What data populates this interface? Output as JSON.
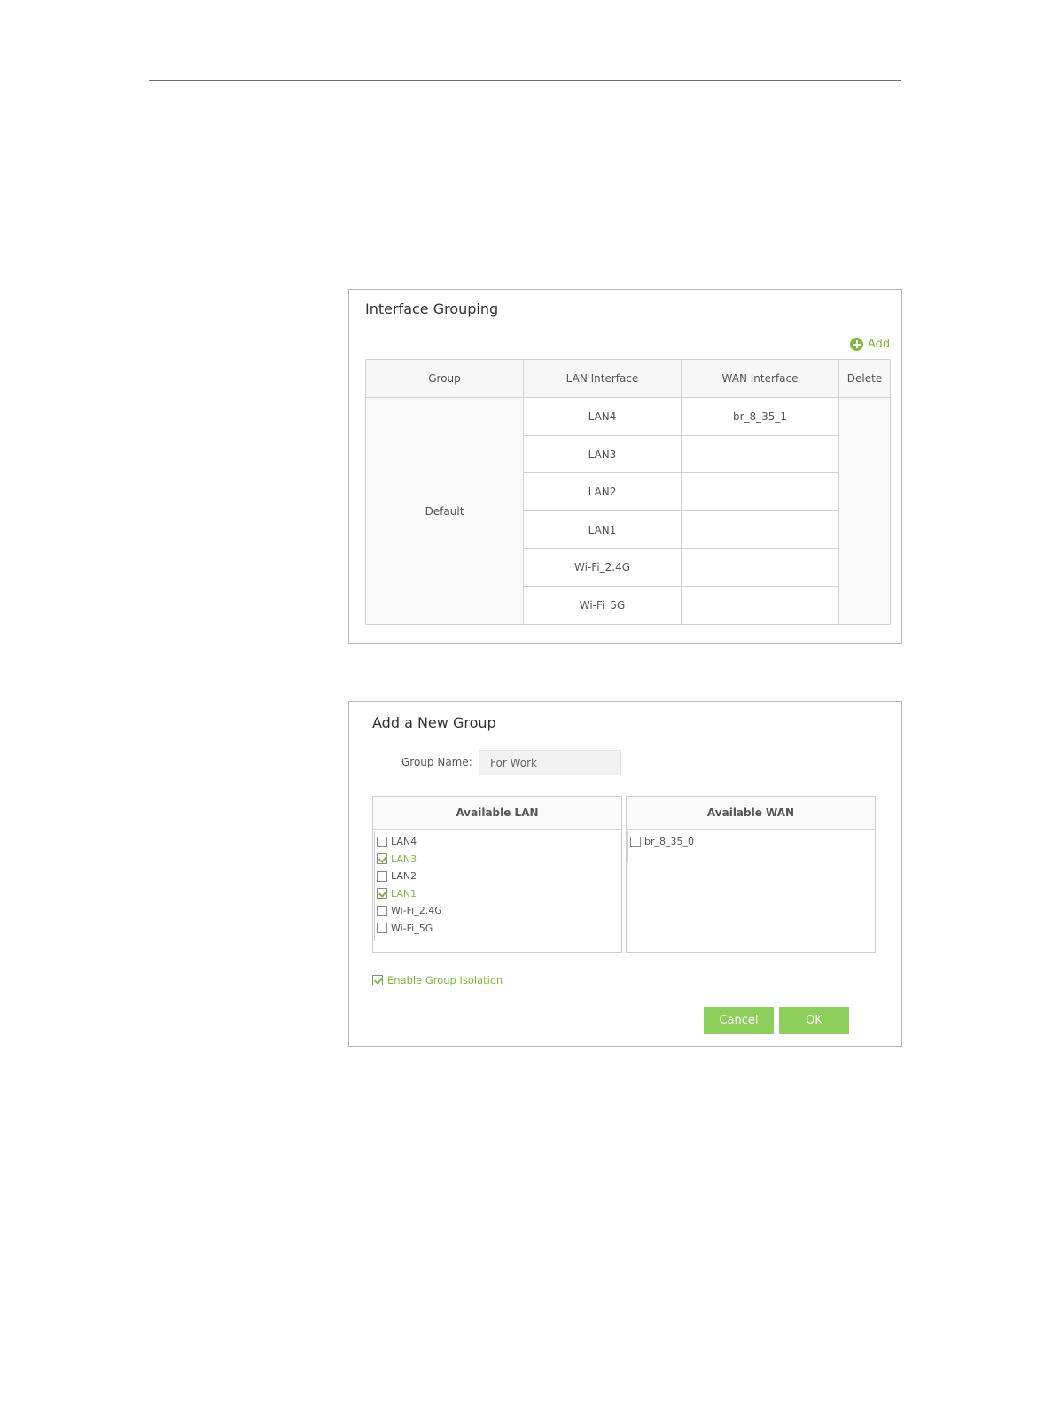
{
  "interface_grouping": {
    "title": "Interface Grouping",
    "add_label": "Add",
    "headers": {
      "group": "Group",
      "lan": "LAN Interface",
      "wan": "WAN Interface",
      "delete": "Delete"
    },
    "group_name": "Default",
    "lan_rows": [
      "LAN4",
      "LAN3",
      "LAN2",
      "LAN1",
      "Wi-Fi_2.4G",
      "Wi-Fi_5G"
    ],
    "wan_rows": [
      "br_8_35_1",
      "",
      "",
      "",
      "",
      ""
    ]
  },
  "add_group": {
    "title": "Add a New Group",
    "group_name_label": "Group Name:",
    "group_name_value": "For Work",
    "available_lan_header": "Available LAN",
    "available_wan_header": "Available WAN",
    "lan_options": [
      {
        "label": "LAN4",
        "checked": false
      },
      {
        "label": "LAN3",
        "checked": true
      },
      {
        "label": "LAN2",
        "checked": false
      },
      {
        "label": "LAN1",
        "checked": true
      },
      {
        "label": "Wi-Fi_2.4G",
        "checked": false
      },
      {
        "label": "Wi-Fi_5G",
        "checked": false
      }
    ],
    "wan_options": [
      {
        "label": "br_8_35_0",
        "checked": false
      }
    ],
    "isolation_label": "Enable Group Isolation",
    "isolation_checked": true,
    "cancel_label": "Cancel",
    "ok_label": "OK"
  },
  "colors": {
    "accent": "#7dbb3a",
    "button": "#8ccf5b",
    "border": "#cfcfcf"
  }
}
